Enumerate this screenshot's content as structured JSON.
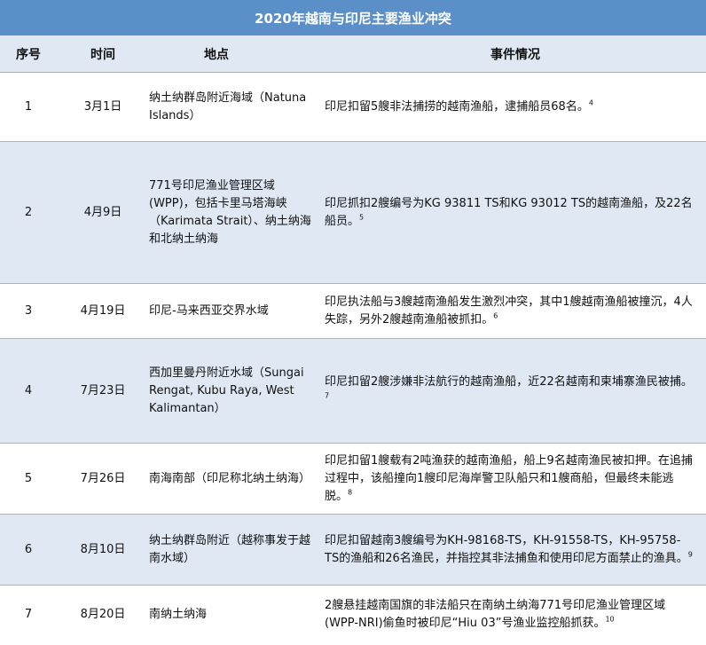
{
  "title": "2020年越南与印尼主要渔业冲突",
  "headers": {
    "num": "序号",
    "time": "时间",
    "location": "地点",
    "event": "事件情况"
  },
  "rows": [
    {
      "num": "1",
      "date": "3月1日",
      "location": "纳土纳群岛附近海域（Natuna Islands）",
      "event": "印尼扣留5艘非法捕捞的越南渔船，逮捕船员68名。",
      "note": "4"
    },
    {
      "num": "2",
      "date": "4月9日",
      "location": "771号印尼渔业管理区域(WPP)，包括卡里马塔海峡（Karimata Strait）、纳土纳海和北纳土纳海",
      "event": "印尼抓扣2艘编号为KG 93811 TS和KG 93012 TS的越南渔船，及22名船员。",
      "note": "5"
    },
    {
      "num": "3",
      "date": "4月19日",
      "location": "印尼-马来西亚交界水域",
      "event": "印尼执法船与3艘越南渔船发生激烈冲突，其中1艘越南渔船被撞沉，4人失踪，另外2艘越南渔船被抓扣。",
      "note": "6"
    },
    {
      "num": "4",
      "date": "7月23日",
      "location": "西加里曼丹附近水域（Sungai Rengat, Kubu Raya, West Kalimantan）",
      "event": "印尼扣留2艘涉嫌非法航行的越南渔船，近22名越南和柬埔寨渔民被捕。",
      "note": "7"
    },
    {
      "num": "5",
      "date": "7月26日",
      "location": "南海南部（印尼称北纳土纳海）",
      "event": "印尼扣留1艘载有2吨渔获的越南渔船，船上9名越南渔民被扣押。在追捕过程中，该船撞向1艘印尼海岸警卫队船只和1艘商船，但最终未能逃脱。",
      "note": "8"
    },
    {
      "num": "6",
      "date": "8月10日",
      "location": "纳土纳群岛附近（越称事发于越南水域）",
      "event": "印尼扣留越南3艘编号为KH-98168-TS，KH-91558-TS，KH-95758-TS的渔船和26名渔民，并指控其非法捕鱼和使用印尼方面禁止的渔具。",
      "note": "9"
    },
    {
      "num": "7",
      "date": "8月20日",
      "location": "南纳土纳海",
      "event": "2艘悬挂越南国旗的非法船只在南纳土纳海771号印尼渔业管理区域(WPP-NRI)偷鱼时被印尼“Hiu 03”号渔业监控船抓获。",
      "note": "10"
    }
  ]
}
